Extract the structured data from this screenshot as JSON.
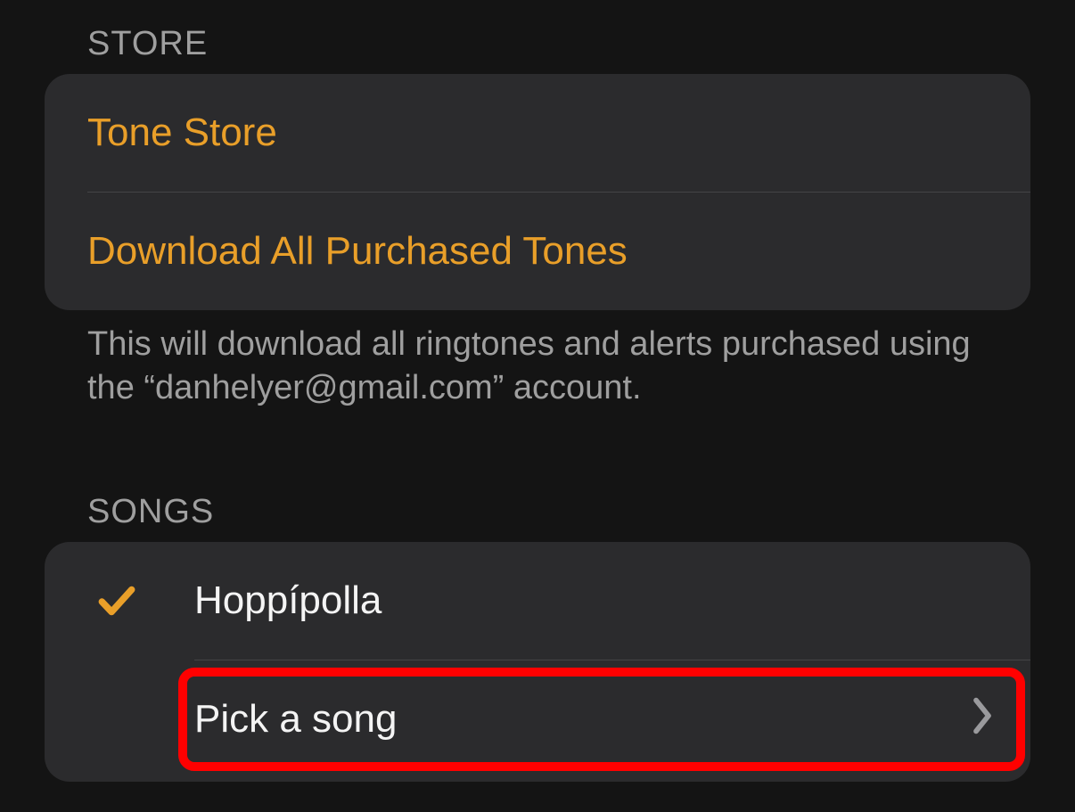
{
  "colors": {
    "accent": "#e99f29"
  },
  "store": {
    "header": "STORE",
    "tone_store_label": "Tone Store",
    "download_all_label": "Download All Purchased Tones",
    "footer": "This will download all ringtones and alerts purchased using the “danhelyer@gmail.com” account."
  },
  "songs": {
    "header": "SONGS",
    "selected_song": "Hoppípolla",
    "pick_label": "Pick a song"
  }
}
